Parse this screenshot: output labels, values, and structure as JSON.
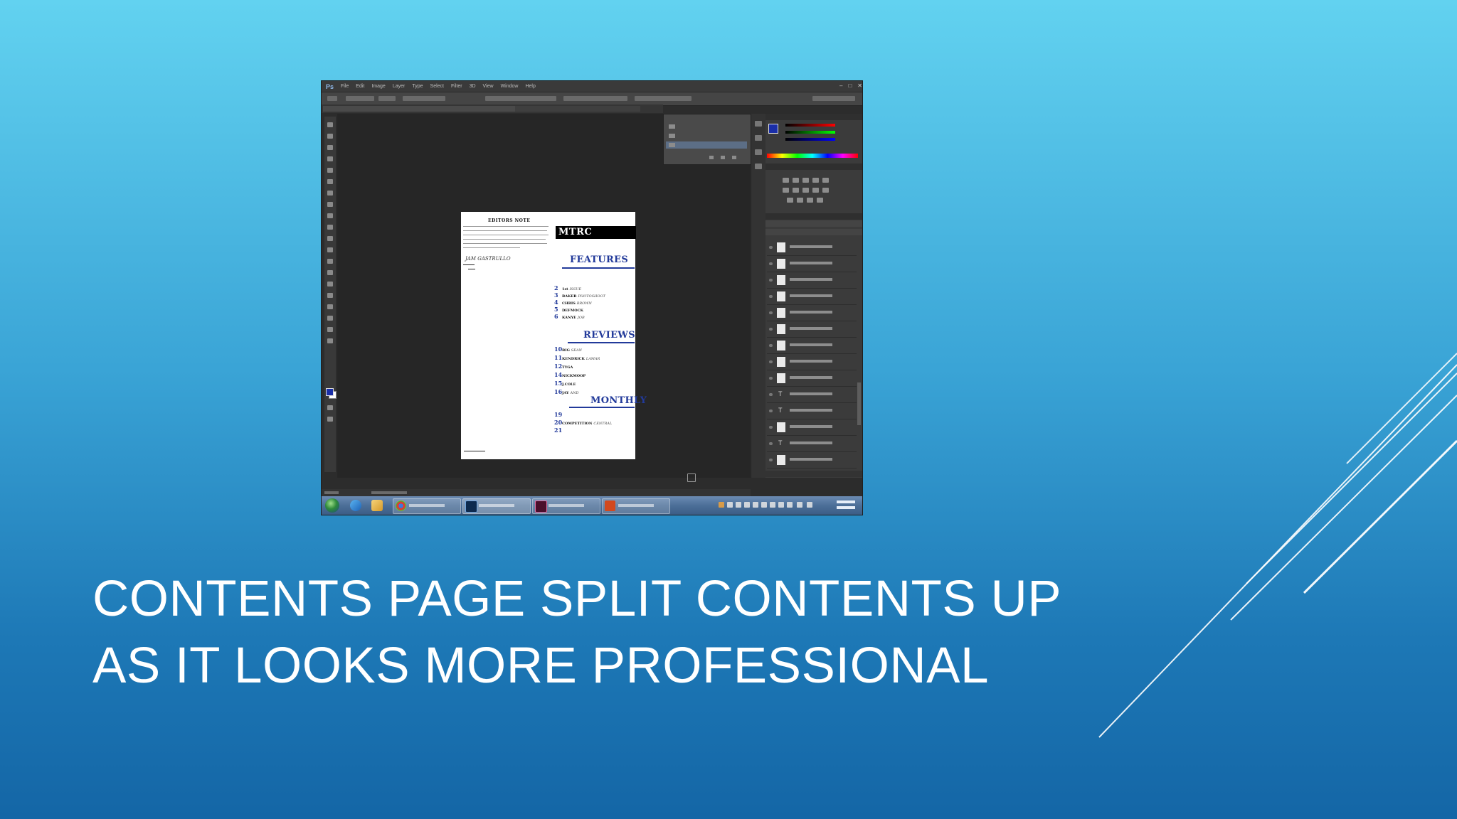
{
  "slide": {
    "title_line1": "CONTENTS PAGE SPLIT CONTENTS UP",
    "title_line2": "AS IT LOOKS MORE PROFESSIONAL"
  },
  "screenshot": {
    "app": "Ps",
    "menu": [
      "File",
      "Edit",
      "Image",
      "Layer",
      "Type",
      "Select",
      "Filter",
      "3D",
      "View",
      "Window",
      "Help"
    ],
    "document": {
      "editors_note_title": "EDITORS NOTE",
      "signature": "JAM GASTRULLO",
      "masthead": "MTRC",
      "sections": [
        {
          "heading": "FEATURES",
          "items": [
            {
              "page": "2",
              "name": "1st",
              "desc": "ISSUE"
            },
            {
              "page": "3",
              "name": "BAKER",
              "desc": "PHOTOSHOOT"
            },
            {
              "page": "4",
              "name": "CHRIS",
              "desc": "BROWN"
            },
            {
              "page": "5",
              "name": "DEFMOCK",
              "desc": ""
            },
            {
              "page": "6",
              "name": "KANYE",
              "desc": "JOB"
            }
          ]
        },
        {
          "heading": "REVIEWS",
          "items": [
            {
              "page": "10",
              "name": "BIG",
              "desc": "SEAN"
            },
            {
              "page": "11",
              "name": "KENDRICK",
              "desc": "LAMAR"
            },
            {
              "page": "12",
              "name": "TYGA",
              "desc": ""
            },
            {
              "page": "14",
              "name": "NICKMOOP",
              "desc": ""
            },
            {
              "page": "15",
              "name": "J.COLE",
              "desc": ""
            },
            {
              "page": "16",
              "name": "JAY",
              "desc": "AND"
            }
          ]
        },
        {
          "heading": "MONTHLY",
          "items": [
            {
              "page": "19",
              "name": "",
              "desc": ""
            },
            {
              "page": "20",
              "name": "COMPETITION",
              "desc": "CENTRAL"
            },
            {
              "page": "21",
              "name": "",
              "desc": ""
            }
          ]
        }
      ]
    },
    "colors": {
      "accent_blue": "#223a9a",
      "foreground_swatch": "#1a2ea8"
    }
  }
}
